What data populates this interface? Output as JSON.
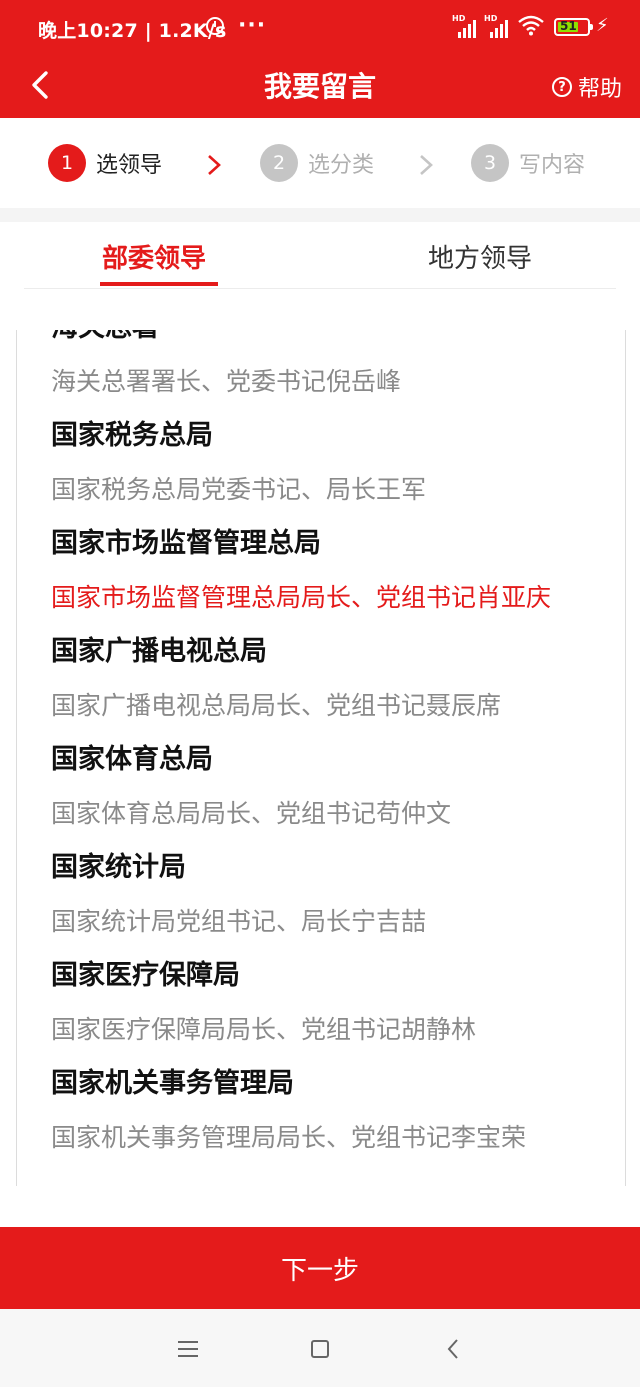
{
  "status_bar": {
    "time_speed": "晚上10:27 | 1.2K/s",
    "more": "···",
    "sim1": "HD",
    "sim2": "HD",
    "battery": "51"
  },
  "header": {
    "title": "我要留言",
    "help_label": "帮助",
    "help_icon_char": "?"
  },
  "steps": [
    {
      "num": "1",
      "label": "选领导",
      "state": "active"
    },
    {
      "num": "2",
      "label": "选分类",
      "state": "inactive"
    },
    {
      "num": "3",
      "label": "写内容",
      "state": "inactive"
    }
  ],
  "tabs": {
    "active": "部委领导",
    "inactive": "地方领导"
  },
  "list": {
    "partial_top": "海关总署",
    "items": [
      {
        "kind": "leader",
        "text": "海关总署署长、党委书记倪岳峰"
      },
      {
        "kind": "org",
        "text": "国家税务总局"
      },
      {
        "kind": "leader",
        "text": "国家税务总局党委书记、局长王军"
      },
      {
        "kind": "org",
        "text": "国家市场监督管理总局"
      },
      {
        "kind": "leader",
        "text": "国家市场监督管理总局局长、党组书记肖亚庆",
        "selected": true
      },
      {
        "kind": "org",
        "text": "国家广播电视总局"
      },
      {
        "kind": "leader",
        "text": "国家广播电视总局局长、党组书记聂辰席"
      },
      {
        "kind": "org",
        "text": "国家体育总局"
      },
      {
        "kind": "leader",
        "text": "国家体育总局局长、党组书记苟仲文"
      },
      {
        "kind": "org",
        "text": "国家统计局"
      },
      {
        "kind": "leader",
        "text": "国家统计局党组书记、局长宁吉喆"
      },
      {
        "kind": "org",
        "text": "国家医疗保障局"
      },
      {
        "kind": "leader",
        "text": "国家医疗保障局局长、党组书记胡静林"
      },
      {
        "kind": "org",
        "text": "国家机关事务管理局"
      },
      {
        "kind": "leader",
        "text": "国家机关事务管理局局长、党组书记李宝荣"
      }
    ]
  },
  "next_button": "下一步",
  "colors": {
    "brand_red": "#e41b1b",
    "inactive_gray": "#c5c5c5",
    "muted_text": "#8a8a8a"
  }
}
